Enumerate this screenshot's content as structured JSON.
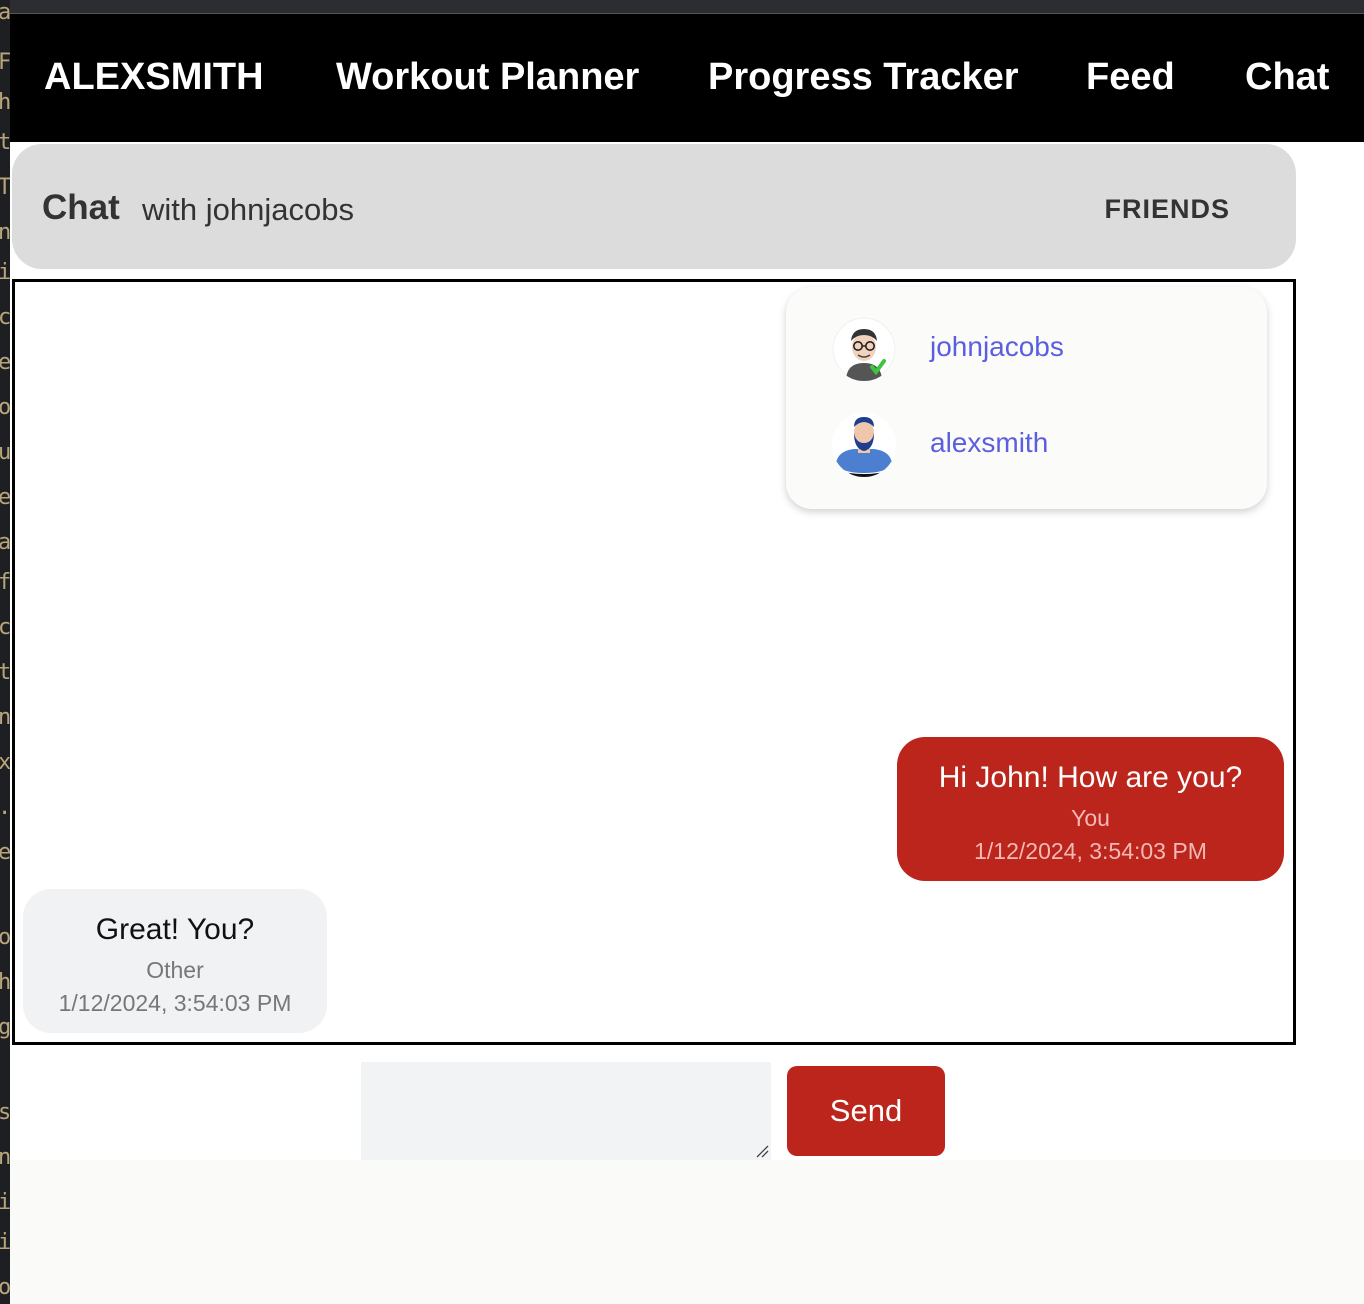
{
  "nav": {
    "brand": "ALEXSMITH",
    "items": [
      "Workout Planner",
      "Progress Tracker",
      "Feed",
      "Chat"
    ]
  },
  "chat_header": {
    "title": "Chat",
    "with_label": "with johnjacobs",
    "friends_button": "FRIENDS"
  },
  "friends": [
    {
      "name": "johnjacobs",
      "avatar": "person-glasses-icon"
    },
    {
      "name": "alexsmith",
      "avatar": "person-beard-icon"
    }
  ],
  "messages": [
    {
      "text": "Hi John! How are you?",
      "sender": "You",
      "time": "1/12/2024, 3:54:03 PM"
    },
    {
      "text": "Great! You?",
      "sender": "Other",
      "time": "1/12/2024, 3:54:03 PM"
    }
  ],
  "composer": {
    "value": "",
    "send_label": "Send"
  },
  "colors": {
    "accent": "#bb251c",
    "link": "#5c5ee0",
    "header_bg": "#dcdcdc",
    "navbar_bg": "#000000"
  }
}
